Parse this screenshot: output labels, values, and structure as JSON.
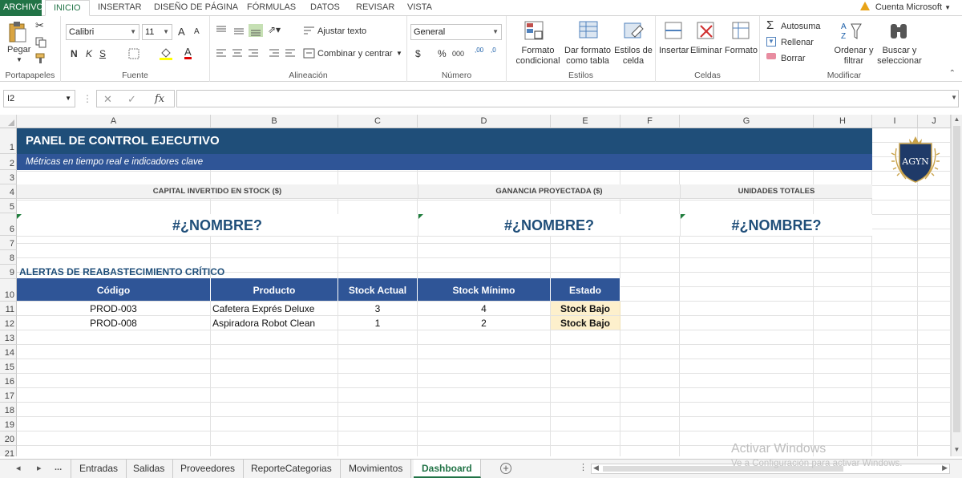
{
  "ribbon_tabs": [
    "ARCHIVO",
    "INICIO",
    "INSERTAR",
    "DISEÑO DE PÁGINA",
    "FÓRMULAS",
    "DATOS",
    "REVISAR",
    "VISTA"
  ],
  "account": "Cuenta Microsoft",
  "ribbon": {
    "clipboard": {
      "label": "Portapapeles",
      "paste": "Pegar"
    },
    "font": {
      "label": "Fuente",
      "name": "Calibri",
      "size": "11",
      "bold": "N",
      "italic": "K",
      "underline": "S",
      "grow": "A",
      "shrink": "A",
      "color": "A"
    },
    "alignment": {
      "label": "Alineación",
      "wrap": "Ajustar texto",
      "merge": "Combinar y centrar"
    },
    "number": {
      "label": "Número",
      "format": "General",
      "currency": "$",
      "percent": "%",
      "thousands": "000",
      "inc_dec": ",00",
      "dec_dec": ",0"
    },
    "styles": {
      "label": "Estilos",
      "conditional": [
        "Formato",
        "condicional"
      ],
      "table": [
        "Dar formato",
        "como tabla"
      ],
      "cell": [
        "Estilos de",
        "celda"
      ]
    },
    "cells": {
      "label": "Celdas",
      "insert": "Insertar",
      "delete": "Eliminar",
      "format": "Formato"
    },
    "editing": {
      "label": "Modificar",
      "autosum": "Autosuma",
      "fill": "Rellenar",
      "clear": "Borrar",
      "sort": [
        "Ordenar y",
        "filtrar"
      ],
      "find": [
        "Buscar y",
        "seleccionar"
      ]
    }
  },
  "formula_bar": {
    "name_box": "I2",
    "cancel": "✕",
    "enter": "✓",
    "fx": "fx",
    "formula": ""
  },
  "columns": [
    "A",
    "B",
    "C",
    "D",
    "E",
    "F",
    "G",
    "H",
    "I",
    "J"
  ],
  "rows": [
    "1",
    "2",
    "3",
    "4",
    "5",
    "6",
    "7",
    "8",
    "9",
    "10",
    "11",
    "12",
    "13",
    "14",
    "15",
    "16",
    "17",
    "18",
    "19",
    "20",
    "21"
  ],
  "dashboard": {
    "title": "PANEL DE CONTROL EJECUTIVO",
    "subtitle": "Métricas en tiempo real e indicadores clave",
    "kpis": [
      {
        "label": "CAPITAL INVERTIDO EN STOCK ($)",
        "value": "#¿NOMBRE?"
      },
      {
        "label": "GANANCIA PROYECTADA ($)",
        "value": "#¿NOMBRE?"
      },
      {
        "label": "UNIDADES TOTALES",
        "value": "#¿NOMBRE?"
      }
    ],
    "alerts_title": "ALERTAS DE REABASTECIMIENTO CRÍTICO",
    "table": {
      "headers": [
        "Código",
        "Producto",
        "Stock Actual",
        "Stock Mínimo",
        "Estado"
      ],
      "rows": [
        [
          "PROD-003",
          "Cafetera Exprés Deluxe",
          "3",
          "4",
          "Stock Bajo"
        ],
        [
          "PROD-008",
          "Aspiradora Robot Clean",
          "1",
          "2",
          "Stock Bajo"
        ]
      ]
    },
    "logo_text": "AGYN"
  },
  "sheet_tabs": [
    "Entradas",
    "Salidas",
    "Proveedores",
    "ReporteCategorias",
    "Movimientos",
    "Dashboard"
  ],
  "active_sheet": "Dashboard",
  "sheet_nav": {
    "prev": "◂",
    "next": "▸",
    "more": "..."
  },
  "watermark": {
    "line1": "Activar Windows",
    "line2": "Ve a Configuración para activar Windows."
  },
  "colors": {
    "excel_green": "#217346",
    "title_blue": "#1f4e79",
    "header_blue": "#2f5597",
    "status_fill": "#fdf0cc"
  }
}
